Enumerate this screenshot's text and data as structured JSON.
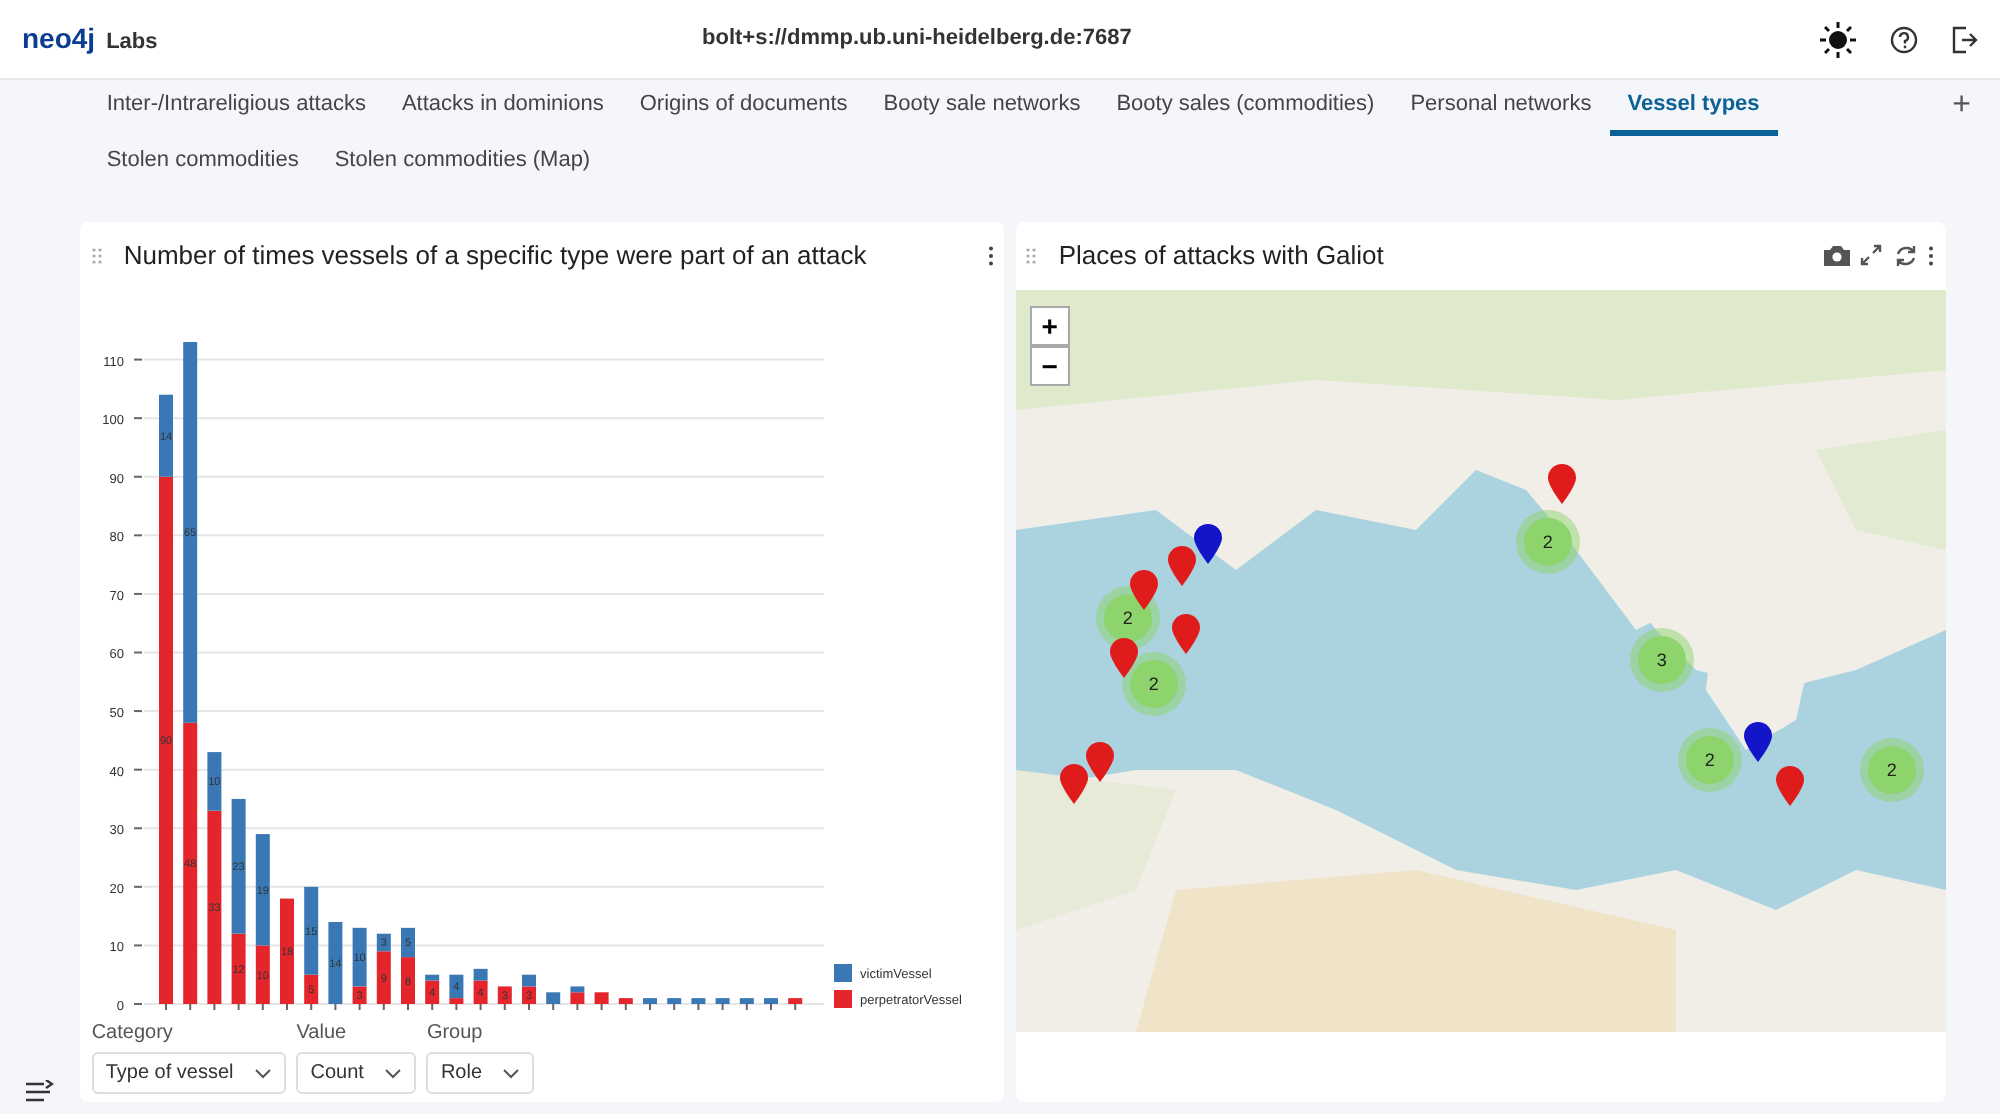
{
  "header": {
    "logo": "neo4j",
    "logo_suffix": "Labs",
    "connection": "bolt+s://dmmp.ub.uni-heidelberg.de:7687"
  },
  "tabs": [
    {
      "label": "Inter-/Intrareligious attacks",
      "selected": false
    },
    {
      "label": "Attacks in dominions",
      "selected": false
    },
    {
      "label": "Origins of documents",
      "selected": false
    },
    {
      "label": "Booty sale networks",
      "selected": false
    },
    {
      "label": "Booty sales (commodities)",
      "selected": false
    },
    {
      "label": "Personal networks",
      "selected": false
    },
    {
      "label": "Vessel types",
      "selected": true
    },
    {
      "label": "Stolen commodities",
      "selected": false
    },
    {
      "label": "Stolen commodities (Map)",
      "selected": false
    }
  ],
  "add_tab": "+",
  "bar_report": {
    "title": "Number of times vessels of a specific type were part of an attack",
    "chart_data": {
      "type": "bar",
      "stacked": true,
      "grid": true,
      "legend": "right",
      "ylim": [
        0,
        113
      ],
      "yticks": [
        0,
        10,
        20,
        30,
        40,
        50,
        60,
        70,
        80,
        90,
        100,
        110
      ],
      "series": [
        {
          "name": "perpetratorVessel",
          "color": "#e4262c",
          "values": [
            90,
            48,
            33,
            12,
            10,
            18,
            5,
            0,
            3,
            9,
            8,
            4,
            1,
            4,
            3,
            3,
            0,
            2,
            2,
            1,
            0,
            0,
            0,
            0,
            0,
            0,
            1
          ],
          "value_labels": [
            "90",
            "48",
            "33",
            "12",
            "10",
            "18",
            "5",
            null,
            "3",
            "9",
            "8",
            "4",
            null,
            "4",
            "3",
            "3",
            null,
            null,
            null,
            null,
            null,
            null,
            null,
            null,
            null,
            null,
            null
          ]
        },
        {
          "name": "victimVessel",
          "color": "#3a78b5",
          "values": [
            14,
            65,
            10,
            23,
            19,
            0,
            15,
            14,
            10,
            3,
            5,
            1,
            4,
            2,
            0,
            2,
            2,
            1,
            0,
            0,
            1,
            1,
            1,
            1,
            1,
            1,
            0
          ],
          "value_labels": [
            "14",
            "65",
            "10",
            "23",
            "19",
            null,
            "15",
            "14",
            "10",
            "3",
            "5",
            null,
            "4",
            null,
            null,
            null,
            null,
            null,
            null,
            null,
            null,
            null,
            null,
            null,
            null,
            null,
            null
          ]
        }
      ]
    },
    "selectors": [
      {
        "label": "Category",
        "value": "Type of vessel"
      },
      {
        "label": "Value",
        "value": "Count"
      },
      {
        "label": "Group",
        "value": "Role"
      }
    ]
  },
  "map_report": {
    "title": "Places of attacks with Galiot",
    "zoom_in": "+",
    "zoom_out": "−",
    "clusters": [
      "2",
      "2",
      "2",
      "3",
      "2",
      "2"
    ],
    "markers": [
      {
        "color": "#e01b1b"
      },
      {
        "color": "#e01b1b"
      },
      {
        "color": "#e01b1b"
      },
      {
        "color": "#e01b1b"
      },
      {
        "color": "#e01b1b"
      },
      {
        "color": "#e01b1b"
      },
      {
        "color": "#e01b1b"
      },
      {
        "color": "#e01b1b"
      },
      {
        "color": "#1414c8"
      },
      {
        "color": "#1414c8"
      }
    ]
  }
}
